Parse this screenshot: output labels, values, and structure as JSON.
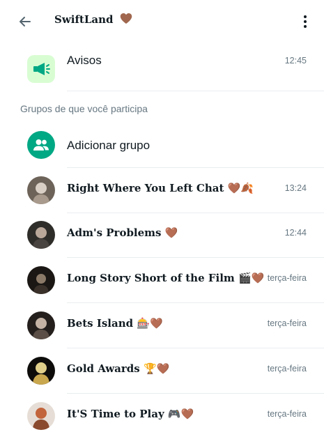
{
  "header": {
    "title": "SwiftLand",
    "icons": {
      "back": "arrow-left-icon",
      "menu": "kebab-menu-icon"
    }
  },
  "announcements": {
    "name": "Avisos",
    "time": "12:45",
    "icon": "megaphone-icon"
  },
  "section": {
    "label": "Grupos de que você participa"
  },
  "add_group": {
    "label": "Adicionar grupo",
    "icon": "group-add-icon"
  },
  "groups": [
    {
      "name": "Right Where You Left Chat",
      "emoji": "🤎🍂",
      "time": "13:24"
    },
    {
      "name": "Adm's Problems",
      "emoji": "🤎",
      "time": "12:44"
    },
    {
      "name": "Long Story Short of the Film",
      "emoji": "🎬🤎",
      "time": "terça-feira"
    },
    {
      "name": "Bets Island",
      "emoji": "🎰🤎",
      "time": "terça-feira"
    },
    {
      "name": "Gold Awards",
      "emoji": "🏆🤎",
      "time": "terça-feira"
    },
    {
      "name": "It'S Time to Play",
      "emoji": "🎮🤎",
      "time": "terça-feira"
    }
  ],
  "colors": {
    "accent": "#00a884",
    "announce_bg": "#d9fdd3",
    "announce_icon": "#00a884",
    "heart": "#a0674e",
    "secondary_text": "#667781"
  }
}
